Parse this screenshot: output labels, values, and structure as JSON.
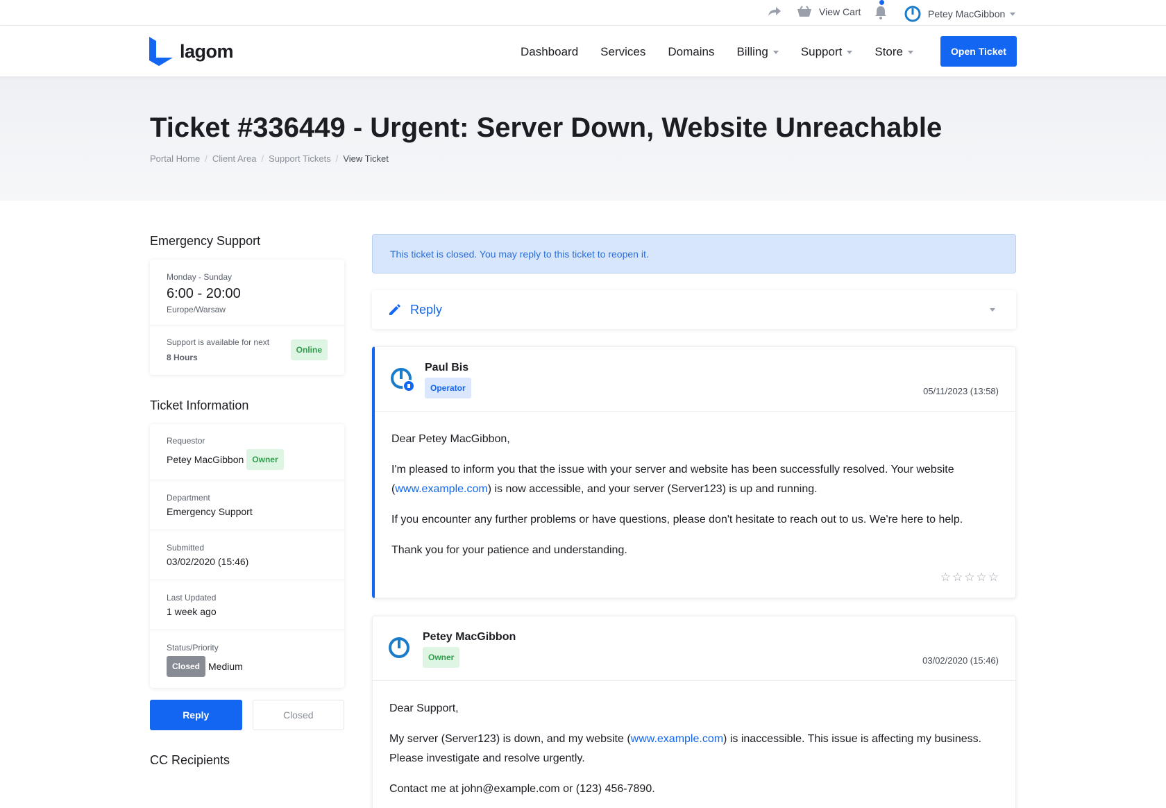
{
  "topbar": {
    "cart_label": "View Cart",
    "user_name": "Petey MacGibbon"
  },
  "nav": {
    "logo_text": "lagom",
    "links": [
      "Dashboard",
      "Services",
      "Domains",
      "Billing",
      "Support",
      "Store"
    ],
    "open_ticket_label": "Open Ticket"
  },
  "header": {
    "title": "Ticket #336449 - Urgent: Server Down, Website Unreachable",
    "breadcrumb": [
      "Portal Home",
      "Client Area",
      "Support Tickets",
      "View Ticket"
    ]
  },
  "sidebar": {
    "emergency": {
      "heading": "Emergency Support",
      "days": "Monday - Sunday",
      "hours": "6:00 - 20:00",
      "timezone": "Europe/Warsaw",
      "availability_text": "Support is available for next",
      "availability_hours": "8 Hours",
      "status_badge": "Online"
    },
    "ticket_info": {
      "heading": "Ticket Information",
      "requestor_label": "Requestor",
      "requestor_value": "Petey MacGibbon",
      "requestor_badge": "Owner",
      "department_label": "Department",
      "department_value": "Emergency Support",
      "submitted_label": "Submitted",
      "submitted_value": "03/02/2020 (15:46)",
      "updated_label": "Last Updated",
      "updated_value": "1 week ago",
      "status_label": "Status/Priority",
      "status_badge": "Closed",
      "priority_value": "Medium"
    },
    "reply_button": "Reply",
    "closed_button": "Closed",
    "cc_heading": "CC Recipients"
  },
  "main": {
    "alert_text": "This ticket is closed. You may reply to this ticket to reopen it.",
    "reply_label": "Reply",
    "messages": [
      {
        "author": "Paul Bis",
        "role": "Operator",
        "date": "05/11/2023 (13:58)",
        "p1": "Dear Petey MacGibbon,",
        "p2a": "I'm pleased to inform you that the issue with your server and website has been successfully resolved. Your website (",
        "p2link": "www.example.com",
        "p2b": ") is now accessible, and your server (Server123) is up and running.",
        "p3": "If you encounter any further problems or have questions, please don't hesitate to reach out to us. We're here to help.",
        "p4": "Thank you for your patience and understanding.",
        "rating": 0
      },
      {
        "author": "Petey MacGibbon",
        "role": "Owner",
        "date": "03/02/2020 (15:46)",
        "p1": "Dear Support,",
        "p2a": "My server (Server123) is down, and my website (",
        "p2link": "www.example.com",
        "p2b": ") is inaccessible. This issue is affecting my business. Please investigate and resolve urgently.",
        "p3": "Contact me at john@example.com or (123) 456-7890."
      }
    ]
  },
  "colors": {
    "accent": "#1266f1",
    "online_green": "#2f9d4c",
    "alert_bg": "#d8e6fc"
  }
}
